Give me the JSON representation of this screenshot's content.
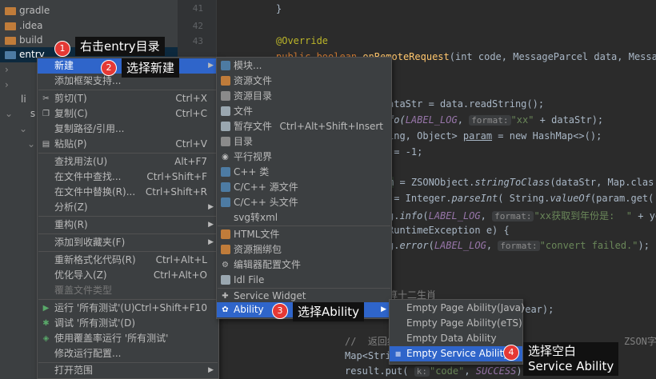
{
  "tree": {
    "items": [
      "gradle",
      ".idea",
      "build",
      "entry",
      "li",
      "s"
    ]
  },
  "gutter": {
    "lines": [
      "41",
      "42",
      "43"
    ]
  },
  "code": {
    "l1": "}",
    "l2": "@Override",
    "l3a": "public boolean ",
    "l3b": "onRemoteRequest",
    "l3c": "(int code, MessageParcel data, Messa",
    "l4": "ataStr = data.readString();",
    "l5a": "fo(",
    "l5b": "LABEL_LOG",
    "l5c": ",",
    "l5hint": "format:",
    "l5d": "\"xx\"",
    "l5e": " + dataStr);",
    "l6a": "ing, Object> ",
    "l6b": "param",
    "l6c": " = new HashMap<>();",
    "l7": " = -1;",
    "l8a": "m",
    "l8b": " = ZSONObject.",
    "l8c": "stringToClass",
    "l8d": "(dataStr, Map.clas",
    "l9a": " = Integer.",
    "l9b": "parseInt",
    "l9c": "( String.",
    "l9d": "valueOf",
    "l9e": "(param.get(",
    "l10a": "g.",
    "l10b": "info",
    "l10c": "(",
    "l10d": "LABEL_LOG",
    "l10e": ",",
    "l10hint": "format:",
    "l10f": "\"xx获取到年份是:  \"",
    "l10g": " + ye",
    "l11": "RuntimeException e) {",
    "l12a": "g.",
    "l12b": "error",
    "l12c": "(",
    "l12d": "LABEL_LOG",
    "l12e": ",",
    "l12hint": "format:",
    "l12f": "\"convert failed.\"",
    "l12g": ");",
    "l13": "算十二生肖",
    "l14": "year);",
    "l15a": "//  返回结",
    "l15b": "ZSON字符串",
    "l16a": "Map<Stri",
    "l16b": "<>();",
    "l17a": "result.put(",
    "l17hint": "k:",
    "l17b": "\"code\"",
    "l17c": ", ",
    "l17d": "SUCCESS",
    "l17e": ");"
  },
  "context_menu": {
    "items": [
      {
        "label": "新建",
        "shortcut": "",
        "submenu": true
      },
      {
        "label": "添加框架支持...",
        "shortcut": ""
      },
      {
        "label": "剪切(T)",
        "shortcut": "Ctrl+X"
      },
      {
        "label": "复制(C)",
        "shortcut": "Ctrl+C"
      },
      {
        "label": "复制路径/引用...",
        "shortcut": ""
      },
      {
        "label": "粘贴(P)",
        "shortcut": "Ctrl+V"
      },
      {
        "label": "查找用法(U)",
        "shortcut": "Alt+F7"
      },
      {
        "label": "在文件中查找...",
        "shortcut": "Ctrl+Shift+F"
      },
      {
        "label": "在文件中替换(R)...",
        "shortcut": "Ctrl+Shift+R"
      },
      {
        "label": "分析(Z)",
        "shortcut": ""
      },
      {
        "label": "重构(R)",
        "shortcut": ""
      },
      {
        "label": "添加到收藏夹(F)",
        "shortcut": ""
      },
      {
        "label": "重新格式化代码(R)",
        "shortcut": "Ctrl+Alt+L"
      },
      {
        "label": "优化导入(Z)",
        "shortcut": "Ctrl+Alt+O"
      },
      {
        "label": "覆盖文件类型",
        "shortcut": ""
      },
      {
        "label": "运行 '所有测试'(U)",
        "shortcut": "Ctrl+Shift+F10"
      },
      {
        "label": "调试 '所有测试'(D)",
        "shortcut": ""
      },
      {
        "label": "使用覆盖率运行 '所有测试'",
        "shortcut": ""
      },
      {
        "label": "修改运行配置...",
        "shortcut": ""
      },
      {
        "label": "打开范围",
        "shortcut": ""
      }
    ]
  },
  "new_menu": {
    "items": [
      {
        "label": "模块..."
      },
      {
        "label": "资源文件"
      },
      {
        "label": "资源目录"
      },
      {
        "label": "文件"
      },
      {
        "label": "暂存文件",
        "shortcut": "Ctrl+Alt+Shift+Insert"
      },
      {
        "label": "目录"
      },
      {
        "label": "平行视界"
      },
      {
        "label": "C++ 类"
      },
      {
        "label": "C/C++ 源文件"
      },
      {
        "label": "C/C++ 头文件"
      },
      {
        "label": "svg转xml"
      },
      {
        "label": "HTML文件"
      },
      {
        "label": "资源捆绑包"
      },
      {
        "label": "编辑器配置文件"
      },
      {
        "label": "Idl File"
      },
      {
        "label": "Service Widget"
      },
      {
        "label": "Ability"
      }
    ]
  },
  "ability_menu": {
    "items": [
      {
        "label": "Empty Page Ability(Java)"
      },
      {
        "label": "Empty Page Ability(eTS)"
      },
      {
        "label": "Empty Data Ability"
      },
      {
        "label": "Empty Service Ability"
      }
    ]
  },
  "annotations": [
    {
      "num": "1",
      "text": "右击entry目录"
    },
    {
      "num": "2",
      "text": "选择新建"
    },
    {
      "num": "3",
      "text": "选择Ability"
    },
    {
      "num": "4",
      "text": "选择空白\nService Ability"
    }
  ]
}
